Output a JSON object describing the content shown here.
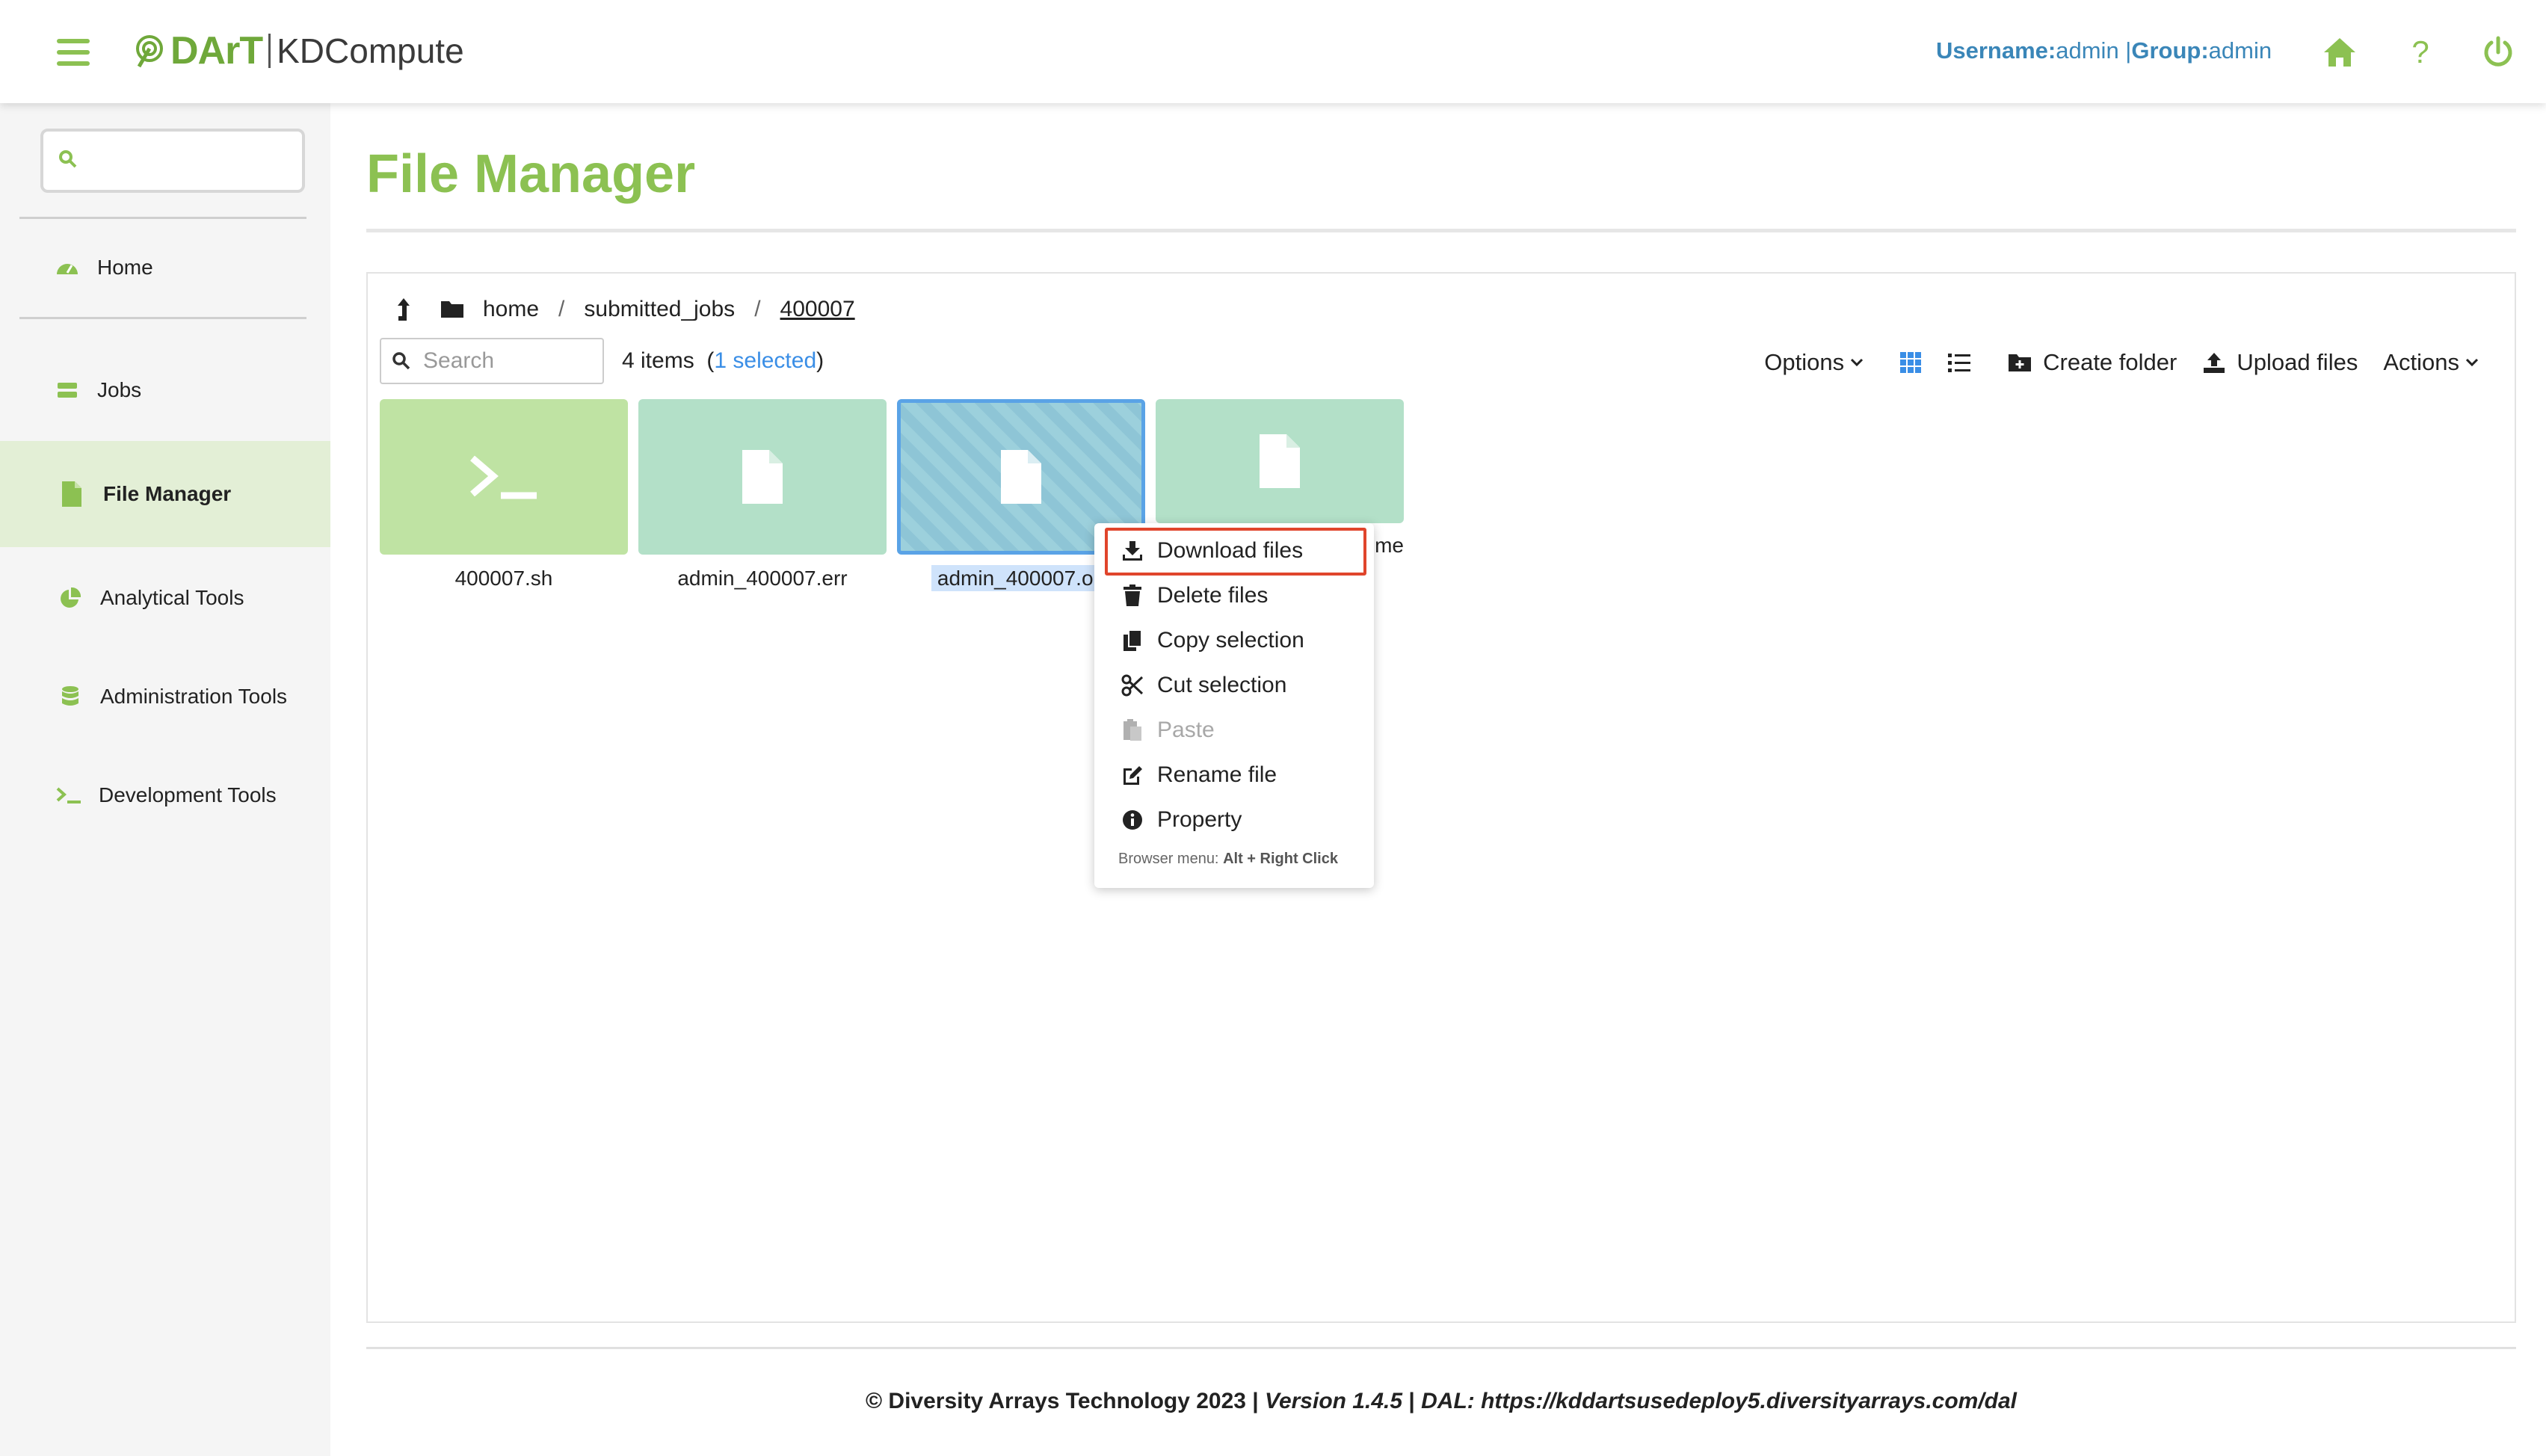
{
  "app": {
    "brand": "DArT",
    "product": "KDCompute"
  },
  "header": {
    "username_label": "Username:",
    "username": "admin",
    "separator": " |",
    "group_label": "Group:",
    "group": "admin",
    "icons": [
      "home-icon",
      "help-icon",
      "power-icon"
    ]
  },
  "sidebar": {
    "search_placeholder": "",
    "items": [
      {
        "label": "Home",
        "icon": "dashboard-icon"
      },
      {
        "label": "Jobs",
        "icon": "server-icon"
      },
      {
        "label": "File Manager",
        "icon": "file-icon"
      },
      {
        "label": "Analytical Tools",
        "icon": "pie-chart-icon"
      },
      {
        "label": "Administration Tools",
        "icon": "database-icon"
      },
      {
        "label": "Development Tools",
        "icon": "terminal-icon"
      }
    ]
  },
  "page": {
    "title": "File Manager"
  },
  "file_manager": {
    "breadcrumb": [
      "home",
      "submitted_jobs",
      "400007"
    ],
    "search_placeholder": "Search",
    "items_count": "4 items",
    "selected_text": "1 selected",
    "toolbar": {
      "options": "Options",
      "create_folder": "Create folder",
      "upload_files": "Upload files",
      "actions": "Actions"
    },
    "files": [
      {
        "name": "400007.sh",
        "type": "script"
      },
      {
        "name": "admin_400007.err",
        "type": "file"
      },
      {
        "name": "admin_400007.ou",
        "type": "file",
        "selected": true
      },
      {
        "name": "me",
        "type": "file"
      }
    ],
    "colors": {
      "script_tile": "#bfe3a3",
      "file_tile": "#b3e0c8",
      "accent": "#8cc152",
      "highlight": "#e0452c"
    }
  },
  "context_menu": {
    "items": [
      {
        "label": "Download files",
        "icon": "download-icon",
        "enabled": true,
        "highlighted": true
      },
      {
        "label": "Delete files",
        "icon": "trash-icon",
        "enabled": true
      },
      {
        "label": "Copy selection",
        "icon": "copy-icon",
        "enabled": true
      },
      {
        "label": "Cut selection",
        "icon": "scissors-icon",
        "enabled": true
      },
      {
        "label": "Paste",
        "icon": "paste-icon",
        "enabled": false
      },
      {
        "label": "Rename file",
        "icon": "edit-icon",
        "enabled": true
      },
      {
        "label": "Property",
        "icon": "info-icon",
        "enabled": true
      }
    ],
    "footer_prefix": "Browser menu: ",
    "footer_keys": "Alt + Right Click"
  },
  "footer": {
    "copyright": "© Diversity Arrays Technology 2023 | ",
    "version": "Version 1.4.5",
    "sep": " | ",
    "dal": "DAL: https://kddartsusedeploy5.diversityarrays.com/dal"
  }
}
